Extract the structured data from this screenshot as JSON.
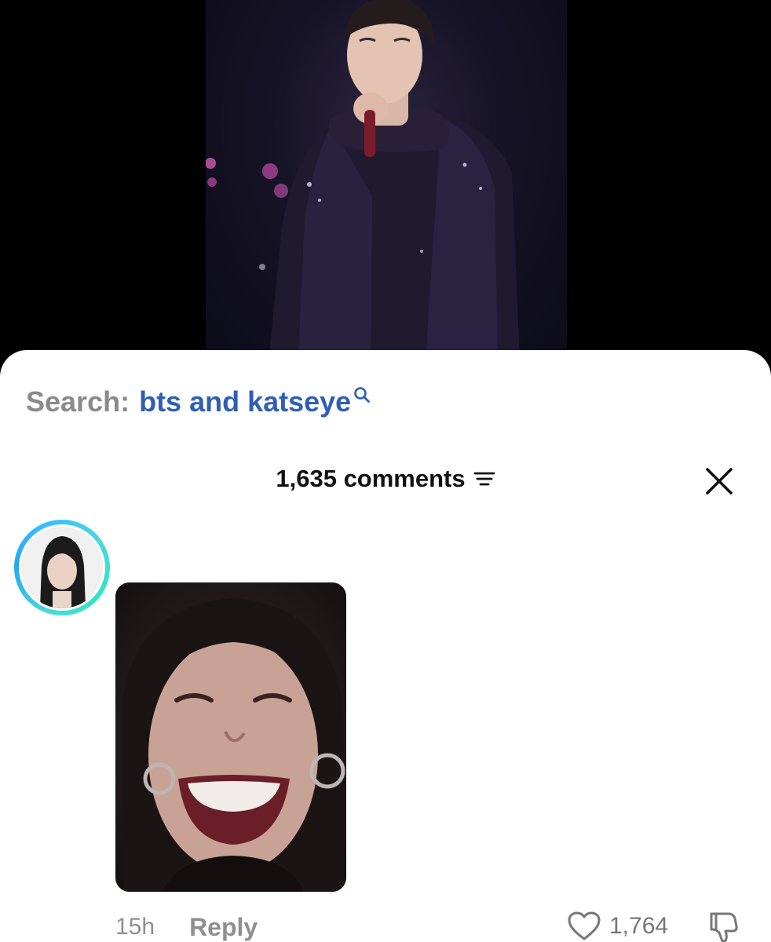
{
  "search": {
    "label": "Search:",
    "query": "bts and katseye"
  },
  "comments": {
    "count_label": "1,635 comments"
  },
  "comment": {
    "time": "15h",
    "reply_label": "Reply",
    "like_count": "1,764"
  },
  "colors": {
    "search_query": "#2f5fb3",
    "avatar_ring": "#3cc0ff"
  },
  "icons": {
    "search": "search-icon",
    "sort": "sort-lines-icon",
    "close": "close-icon",
    "like": "heart-icon",
    "dislike": "thumbs-down-icon"
  }
}
